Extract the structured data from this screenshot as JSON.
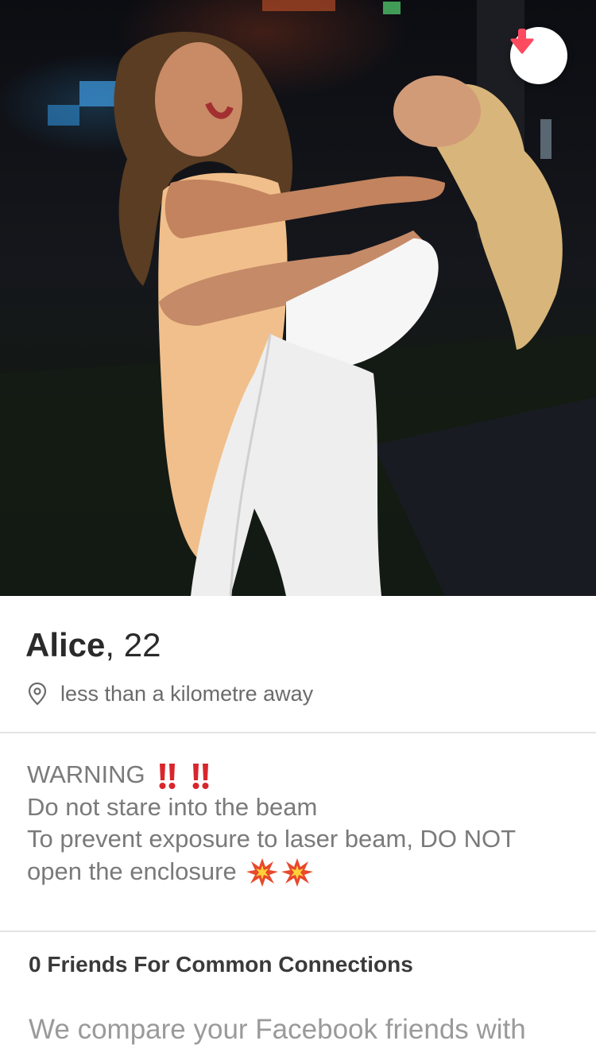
{
  "photo": {
    "alt": "Profile photo",
    "action_icon": "arrow-down-icon",
    "accent_color": "#fd4a5f"
  },
  "profile": {
    "name": "Alice",
    "age_sep": ", ",
    "age": "22",
    "distance": "less than a kilometre away",
    "location_icon": "location-pin-icon"
  },
  "bio": {
    "lines": [
      "WARNING",
      "Do not stare into the beam",
      "To prevent exposure to laser beam, DO NOT",
      "open the enclosure"
    ],
    "emoji_after_warning": "double-exclamation-icon",
    "emoji_after_enclosure": "collision-icon"
  },
  "connections": {
    "title": "0 Friends For Common Connections",
    "text": "We compare your Facebook friends with"
  }
}
